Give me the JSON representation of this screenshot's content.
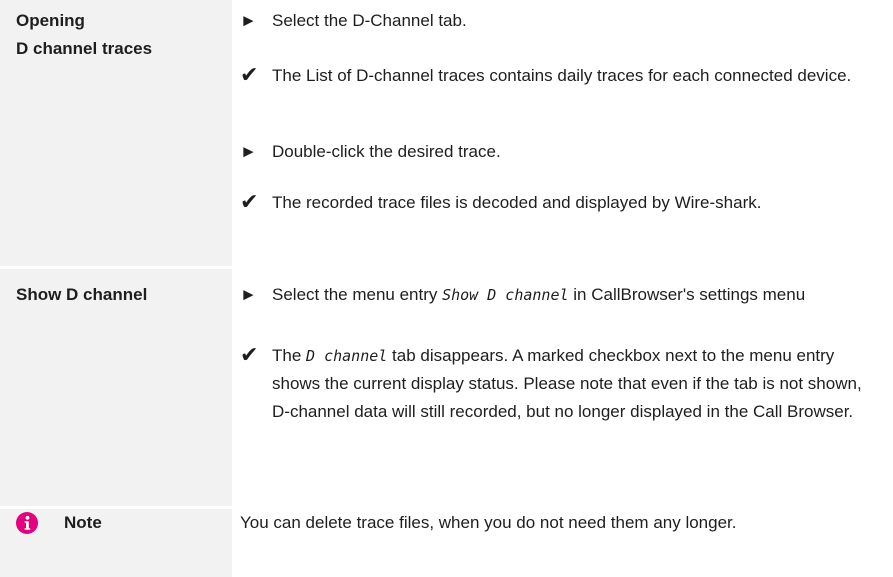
{
  "rows": [
    {
      "label_lines": [
        "Opening",
        "D channel traces"
      ],
      "steps": [
        {
          "marker": "►",
          "marker_icon": "arrow-right-icon",
          "text": "Select the D-Channel tab."
        },
        {
          "marker": "✔",
          "marker_icon": "check-icon",
          "text": "The List of D-channel traces contains daily traces for each connected device."
        },
        {
          "marker": "►",
          "marker_icon": "arrow-right-icon",
          "text": "Double-click the desired trace."
        },
        {
          "marker": "✔",
          "marker_icon": "check-icon",
          "text": "The recorded trace files is decoded and displayed by Wire-shark."
        }
      ]
    },
    {
      "label": "Show D channel",
      "steps": [
        {
          "marker": "►",
          "marker_icon": "arrow-right-icon",
          "pre": "Select the menu entry ",
          "code": "Show D channel",
          "post": " in CallBrowser's settings menu"
        },
        {
          "marker": "✔",
          "marker_icon": "check-icon",
          "pre": "The ",
          "code": "D channel",
          "post": " tab disappears. A marked checkbox next to the menu entry shows the current display status. Please note that even if the tab is not shown, D-channel data will still recorded, but no longer displayed in the Call Browser."
        }
      ]
    },
    {
      "label": "Note",
      "icon": "info-icon",
      "icon_color": "#e5007d",
      "text": "You can delete trace files, when you do not need them any longer."
    }
  ],
  "colors": {
    "label_bg": "#f2f2f2",
    "text": "#1e1e1e",
    "note_icon": "#e5007d"
  }
}
